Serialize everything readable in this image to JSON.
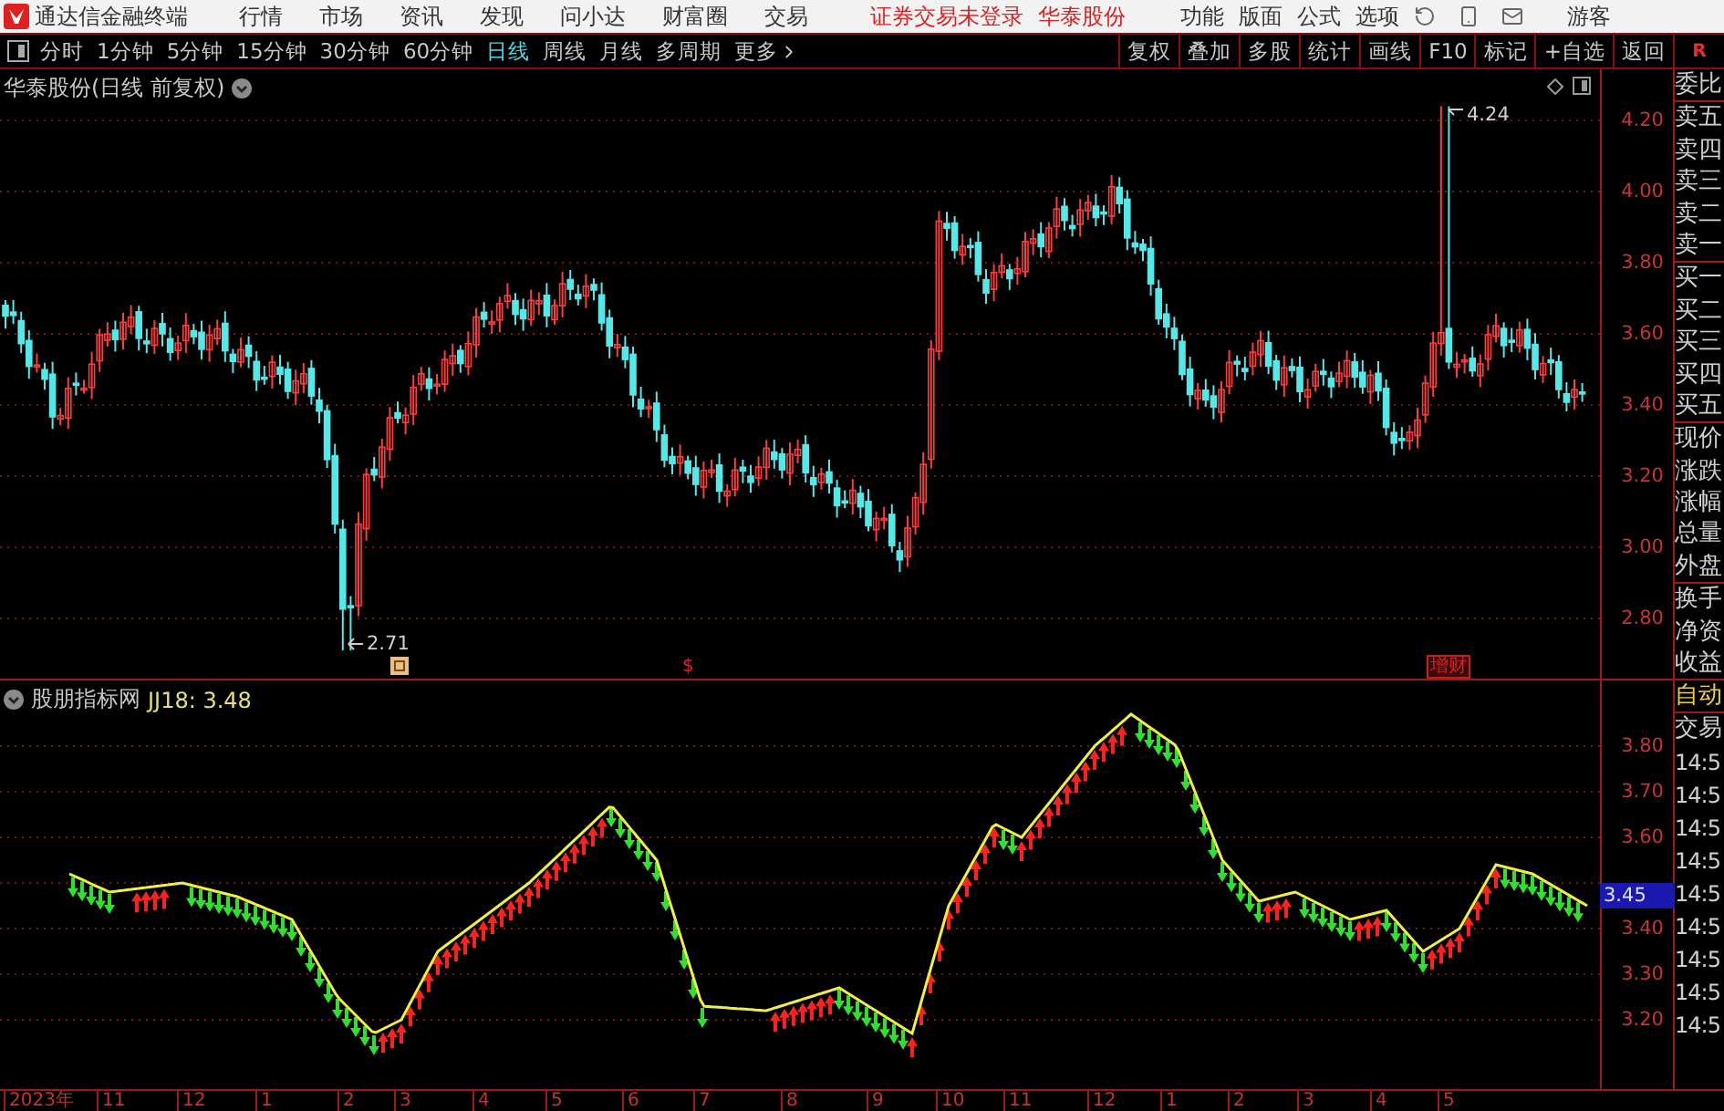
{
  "menu_bar": {
    "app_title": "通达信金融终端",
    "menus": [
      "行情",
      "市场",
      "资讯",
      "发现",
      "问小达",
      "财富圈",
      "交易"
    ],
    "login_status": "证券交易未登录",
    "broker": "华泰股份",
    "tools": [
      "功能",
      "版面",
      "公式",
      "选项"
    ],
    "user": "游客"
  },
  "toolbar": {
    "periods": [
      {
        "label": "分时",
        "selected": false
      },
      {
        "label": "1分钟",
        "selected": false
      },
      {
        "label": "5分钟",
        "selected": false
      },
      {
        "label": "15分钟",
        "selected": false
      },
      {
        "label": "30分钟",
        "selected": false
      },
      {
        "label": "60分钟",
        "selected": false
      },
      {
        "label": "日线",
        "selected": true
      },
      {
        "label": "周线",
        "selected": false
      },
      {
        "label": "月线",
        "selected": false
      },
      {
        "label": "多周期",
        "selected": false
      },
      {
        "label": "更多",
        "selected": false
      }
    ],
    "actions": [
      "复权",
      "叠加",
      "多股",
      "统计",
      "画线",
      "F10",
      "标记",
      "+自选",
      "返回"
    ],
    "marker": "R"
  },
  "price_chart": {
    "title": "华泰股份(日线 前复权)",
    "high_label": "4.24",
    "low_label": "2.71",
    "events": [
      {
        "kind": "symbol",
        "label": "$"
      },
      {
        "kind": "badge",
        "label": "增财"
      }
    ],
    "yticks": [
      "4.20",
      "4.00",
      "3.80",
      "3.60",
      "3.40",
      "3.20",
      "3.00",
      "2.80"
    ]
  },
  "indicator_chart": {
    "name": "股朋指标网",
    "value": "JJ18: 3.48",
    "current": "3.45",
    "yticks": [
      "3.80",
      "3.70",
      "3.60",
      "3.40",
      "3.30",
      "3.20"
    ]
  },
  "quote_panel": {
    "fields": [
      "委比",
      "卖五",
      "卖四",
      "卖三",
      "卖二",
      "卖一",
      "买一",
      "买二",
      "买三",
      "买四",
      "买五",
      "现价",
      "涨跌",
      "涨幅",
      "总量",
      "外盘",
      "换手",
      "净资",
      "收益"
    ],
    "mode": "自动",
    "trade": "交易",
    "times": [
      "14:5",
      "14:5",
      "14:5",
      "14:5",
      "14:5",
      "14:5",
      "14:5",
      "14:5",
      "14:5"
    ]
  },
  "date_axis": [
    "2023年",
    "11",
    "12",
    "1",
    "2",
    "3",
    "4",
    "5",
    "6",
    "7",
    "8",
    "9",
    "10",
    "11",
    "12",
    "1",
    "2",
    "3",
    "4",
    "5"
  ]
}
